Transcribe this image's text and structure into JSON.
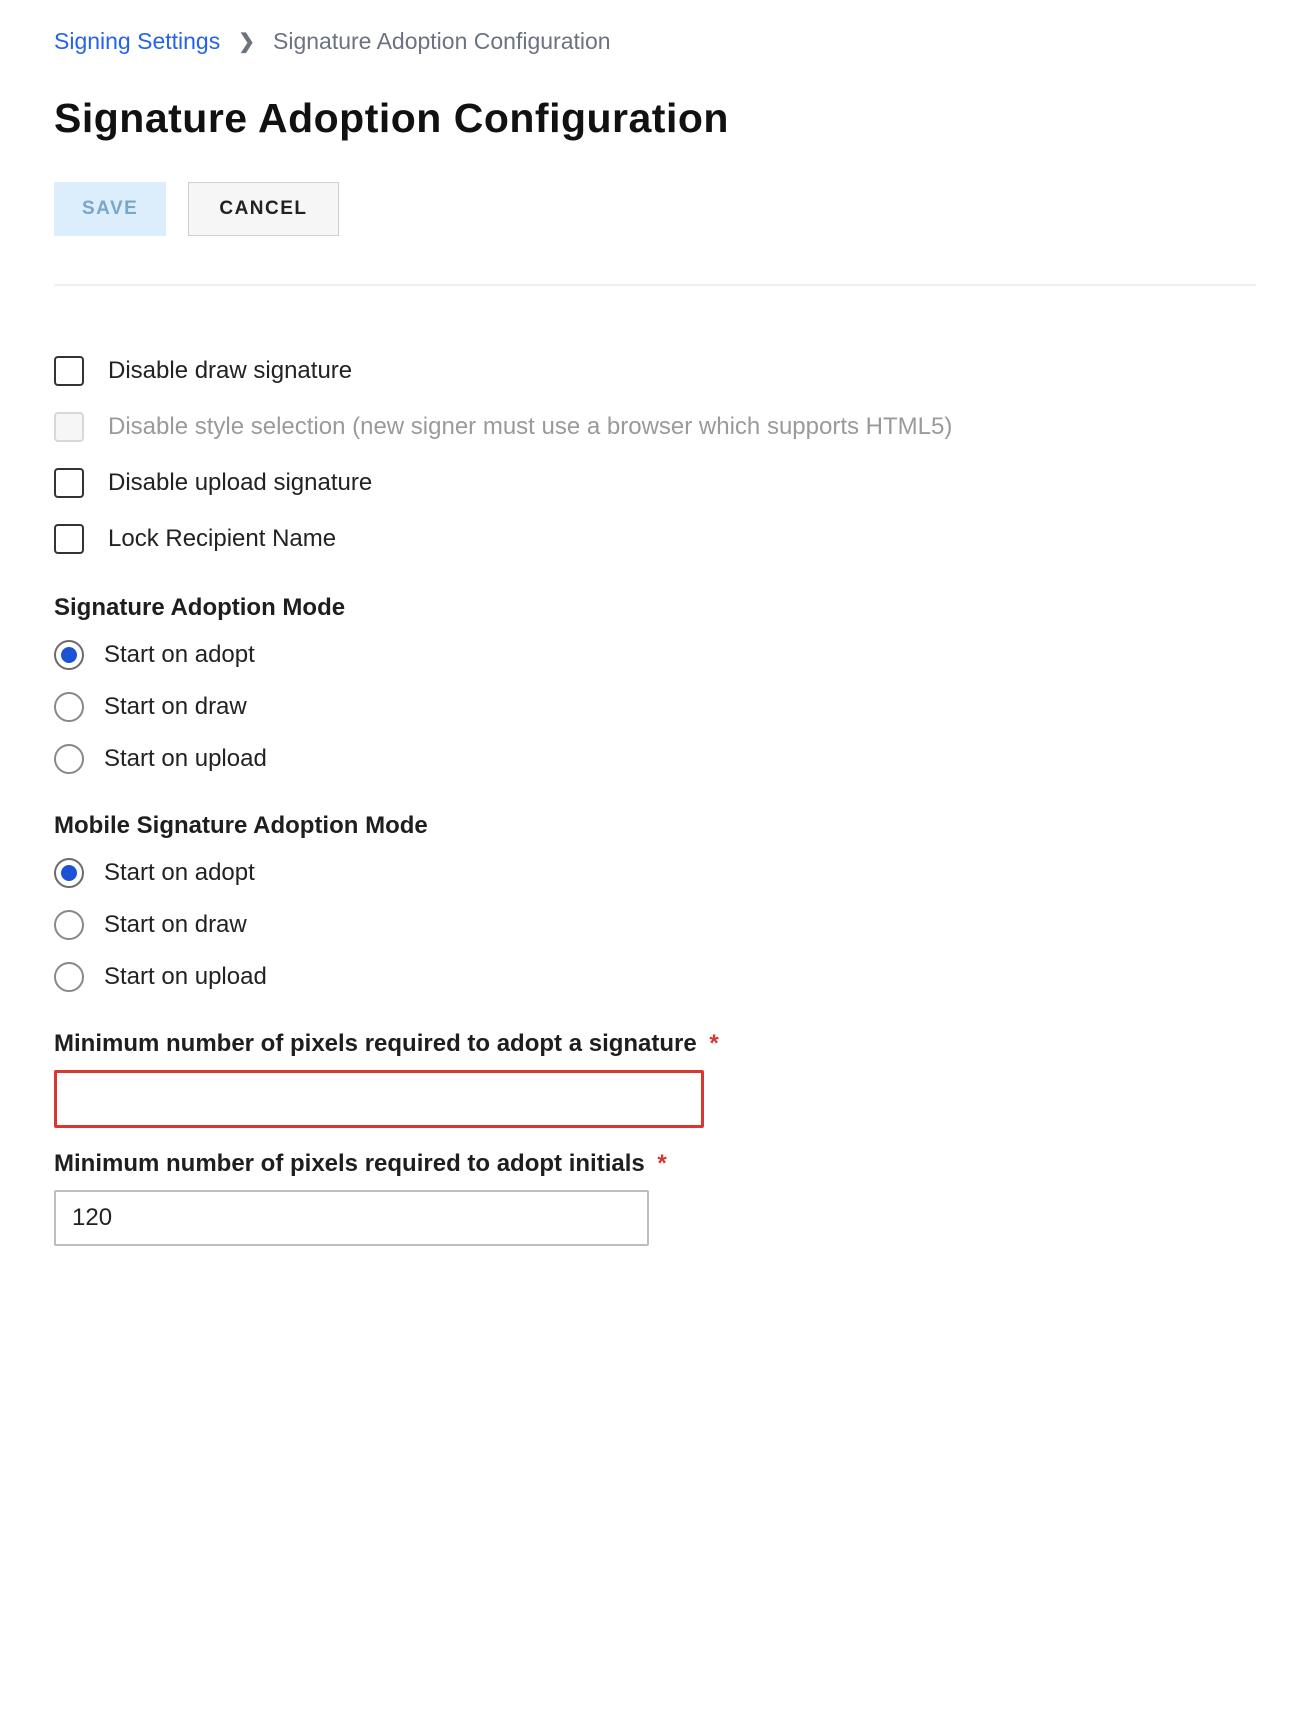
{
  "breadcrumb": {
    "parent": "Signing Settings",
    "current": "Signature Adoption Configuration"
  },
  "title": "Signature Adoption Configuration",
  "buttons": {
    "save": "SAVE",
    "cancel": "CANCEL"
  },
  "checkboxes": {
    "disable_draw": "Disable draw signature",
    "disable_style": "Disable style selection (new signer must use a browser which supports HTML5)",
    "disable_upload": "Disable upload signature",
    "lock_recipient": "Lock Recipient Name"
  },
  "signature_mode": {
    "heading": "Signature Adoption Mode",
    "options": {
      "adopt": "Start on adopt",
      "draw": "Start on draw",
      "upload": "Start on upload"
    }
  },
  "mobile_mode": {
    "heading": "Mobile Signature Adoption Mode",
    "options": {
      "adopt": "Start on adopt",
      "draw": "Start on draw",
      "upload": "Start on upload"
    }
  },
  "fields": {
    "min_pixels_signature": {
      "label": "Minimum number of pixels required to adopt a signature",
      "value": ""
    },
    "min_pixels_initials": {
      "label": "Minimum number of pixels required to adopt initials",
      "value": "120"
    }
  },
  "required_marker": "*"
}
